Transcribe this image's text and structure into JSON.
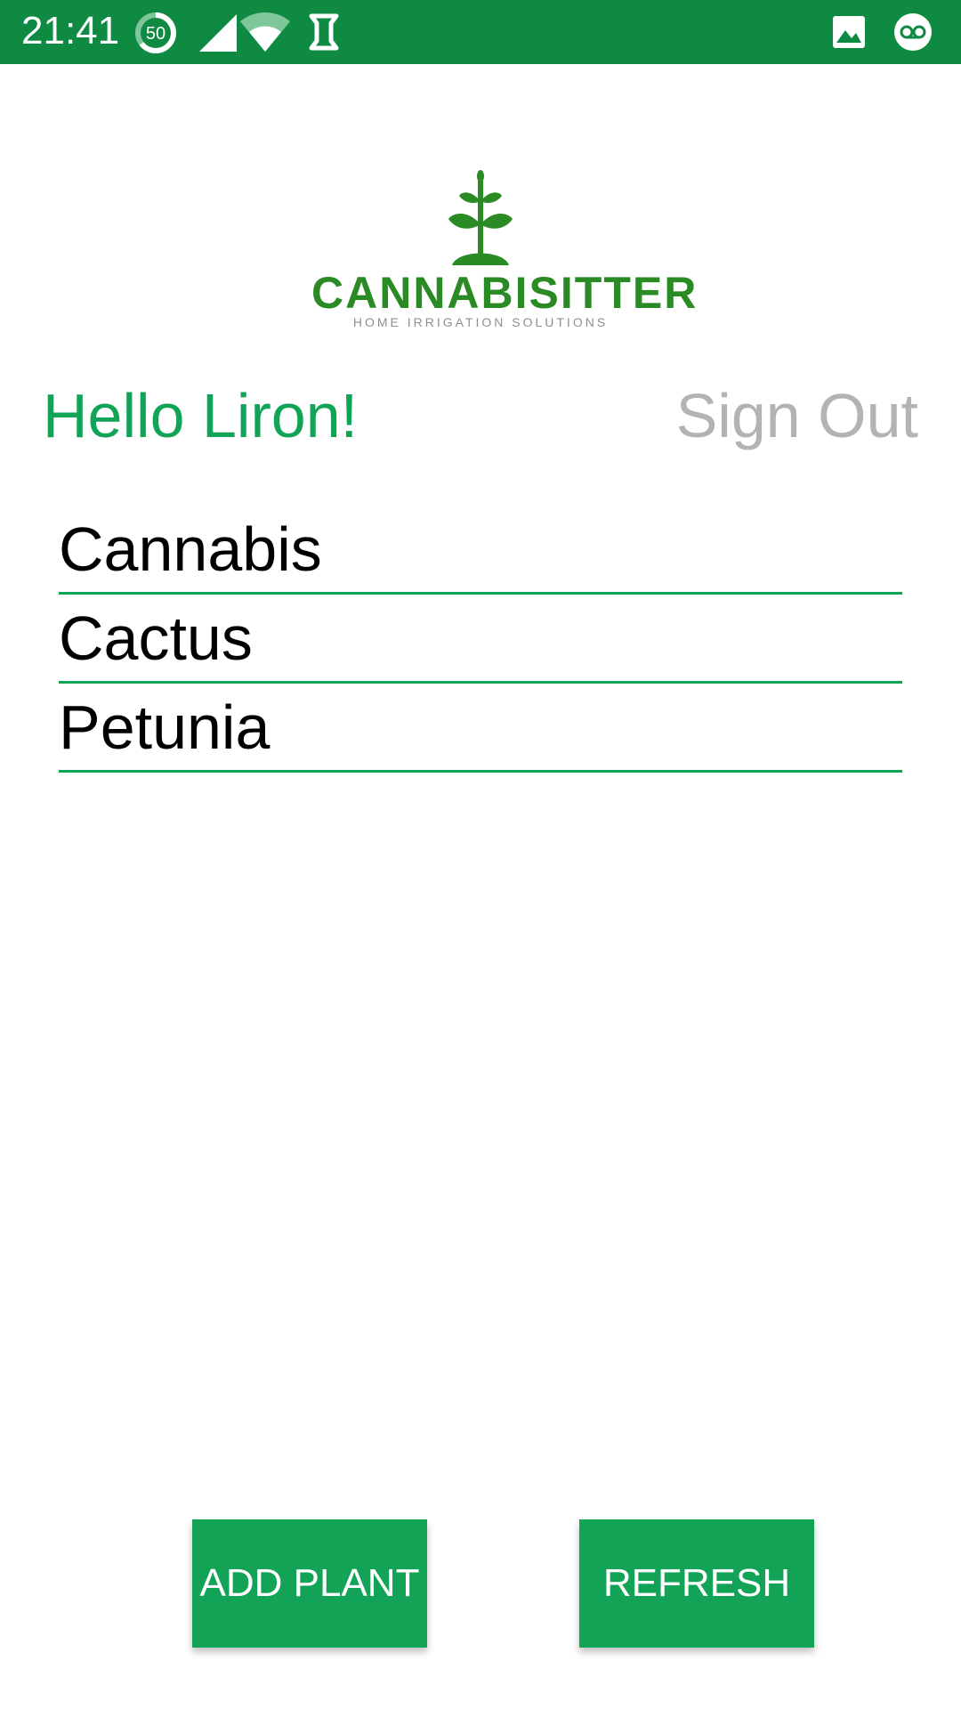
{
  "status_bar": {
    "time": "21:41",
    "battery_badge": "50",
    "icons": [
      "data-saver-icon",
      "cell-signal-icon",
      "wifi-icon",
      "sync-icon",
      "image-notification-icon",
      "voicemail-icon"
    ],
    "color": "#0f8a43"
  },
  "logo": {
    "wordmark": "CANNABISITTER",
    "tagline": "HOME IRRIGATION SOLUTIONS",
    "icon": "plant-sprout-icon",
    "color": "#2a8a24"
  },
  "header": {
    "greeting": "Hello Liron!",
    "sign_out_label": "Sign Out",
    "accent_color": "#11a356"
  },
  "plants": [
    {
      "name": "Cannabis"
    },
    {
      "name": "Cactus"
    },
    {
      "name": "Petunia"
    }
  ],
  "actions": {
    "add_plant_label": "ADD PLANT",
    "refresh_label": "REFRESH",
    "button_color": "#13a356"
  }
}
